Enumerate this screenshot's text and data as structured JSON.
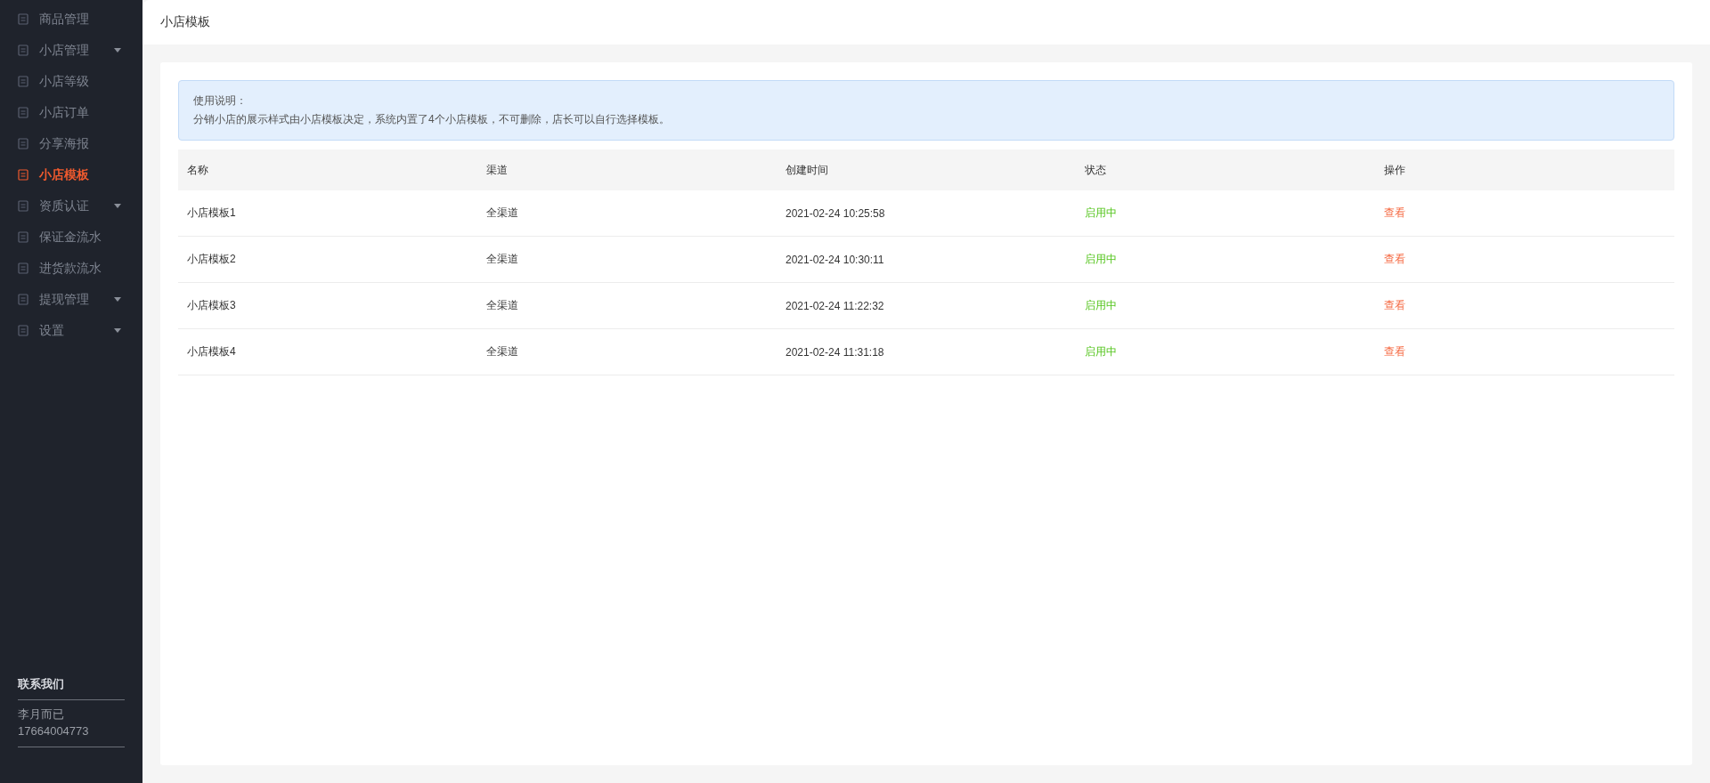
{
  "sidebar": {
    "items": [
      {
        "label": "商品管理",
        "selected": false,
        "expandable": false
      },
      {
        "label": "小店管理",
        "selected": false,
        "expandable": true
      },
      {
        "label": "小店等级",
        "selected": false,
        "expandable": false
      },
      {
        "label": "小店订单",
        "selected": false,
        "expandable": false
      },
      {
        "label": "分享海报",
        "selected": false,
        "expandable": false
      },
      {
        "label": "小店模板",
        "selected": true,
        "expandable": false
      },
      {
        "label": "资质认证",
        "selected": false,
        "expandable": true
      },
      {
        "label": "保证金流水",
        "selected": false,
        "expandable": false
      },
      {
        "label": "进货款流水",
        "selected": false,
        "expandable": false
      },
      {
        "label": "提现管理",
        "selected": false,
        "expandable": true
      },
      {
        "label": "设置",
        "selected": false,
        "expandable": true
      }
    ],
    "contact": {
      "title": "联系我们",
      "name": "李月而已",
      "phone": "17664004773"
    }
  },
  "page": {
    "title": "小店模板"
  },
  "notice": {
    "title": "使用说明：",
    "text": "分销小店的展示样式由小店模板决定，系统内置了4个小店模板，不可删除，店长可以自行选择模板。"
  },
  "table": {
    "columns": [
      "名称",
      "渠道",
      "创建时间",
      "状态",
      "操作"
    ],
    "rows": [
      {
        "name": "小店模板1",
        "channel": "全渠道",
        "created": "2021-02-24 10:25:58",
        "status": {
          "label": "启用中",
          "kind": "enabled"
        },
        "action": "查看"
      },
      {
        "name": "小店模板2",
        "channel": "全渠道",
        "created": "2021-02-24 10:30:11",
        "status": {
          "label": "启用中",
          "kind": "enabled"
        },
        "action": "查看"
      },
      {
        "name": "小店模板3",
        "channel": "全渠道",
        "created": "2021-02-24 11:22:32",
        "status": {
          "label": "启用中",
          "kind": "enabled"
        },
        "action": "查看"
      },
      {
        "name": "小店模板4",
        "channel": "全渠道",
        "created": "2021-02-24 11:31:18",
        "status": {
          "label": "启用中",
          "kind": "enabled"
        },
        "action": "查看"
      }
    ]
  }
}
